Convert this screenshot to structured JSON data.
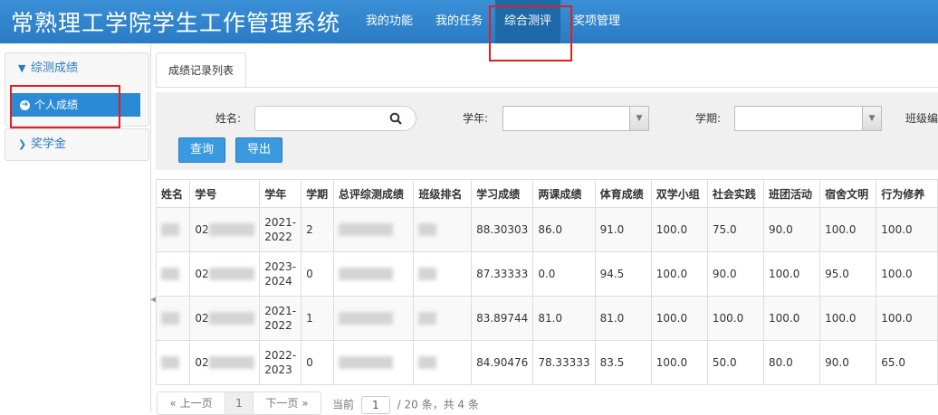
{
  "app": {
    "title": "常熟理工学院学生工作管理系统"
  },
  "nav": [
    {
      "label": "我的功能"
    },
    {
      "label": "我的任务"
    },
    {
      "label": "综合测评"
    },
    {
      "label": "奖项管理"
    }
  ],
  "sidebar": {
    "group1": {
      "label": "综测成绩",
      "items": [
        {
          "label": "个人成绩"
        }
      ]
    },
    "group2": {
      "label": "奖学金"
    }
  },
  "tab": {
    "label": "成绩记录列表"
  },
  "search": {
    "name_label": "姓名:",
    "name_value": "",
    "year_label": "学年:",
    "term_label": "学期:",
    "class_label": "班级编",
    "query_button": "查询",
    "export_button": "导出"
  },
  "table": {
    "headers": [
      "姓名",
      "学号",
      "学年",
      "学期",
      "总评综测成绩",
      "班级排名",
      "学习成绩",
      "两课成绩",
      "体育成绩",
      "双学小组",
      "社会实践",
      "班团活动",
      "宿舍文明",
      "行为修养"
    ],
    "rows": [
      {
        "id_prefix": "02",
        "year": "2021-2022",
        "term": "2",
        "study": "88.30303",
        "politics": "86.0",
        "pe": "91.0",
        "group": "100.0",
        "social": "75.0",
        "league": "90.0",
        "dorm": "100.0",
        "behavior": "100.0"
      },
      {
        "id_prefix": "02",
        "year": "2023-2024",
        "term": "0",
        "study": "87.33333",
        "politics": "0.0",
        "pe": "94.5",
        "group": "100.0",
        "social": "90.0",
        "league": "100.0",
        "dorm": "95.0",
        "behavior": "100.0"
      },
      {
        "id_prefix": "02",
        "year": "2021-2022",
        "term": "1",
        "study": "83.89744",
        "politics": "81.0",
        "pe": "81.0",
        "group": "100.0",
        "social": "100.0",
        "league": "100.0",
        "dorm": "100.0",
        "behavior": "100.0"
      },
      {
        "id_prefix": "02",
        "year": "2022-2023",
        "term": "0",
        "study": "84.90476",
        "politics": "78.33333",
        "pe": "83.5",
        "group": "100.0",
        "social": "50.0",
        "league": "80.0",
        "dorm": "90.0",
        "behavior": "65.0"
      }
    ]
  },
  "pagination": {
    "prev": "« 上一页",
    "page": "1",
    "next": "下一页 »",
    "current_label": "当前",
    "current_value": "1",
    "total_text": "/ 20 条，共 4 条"
  },
  "colors": {
    "accent": "#2a7bc4",
    "highlight": "#e02020"
  }
}
